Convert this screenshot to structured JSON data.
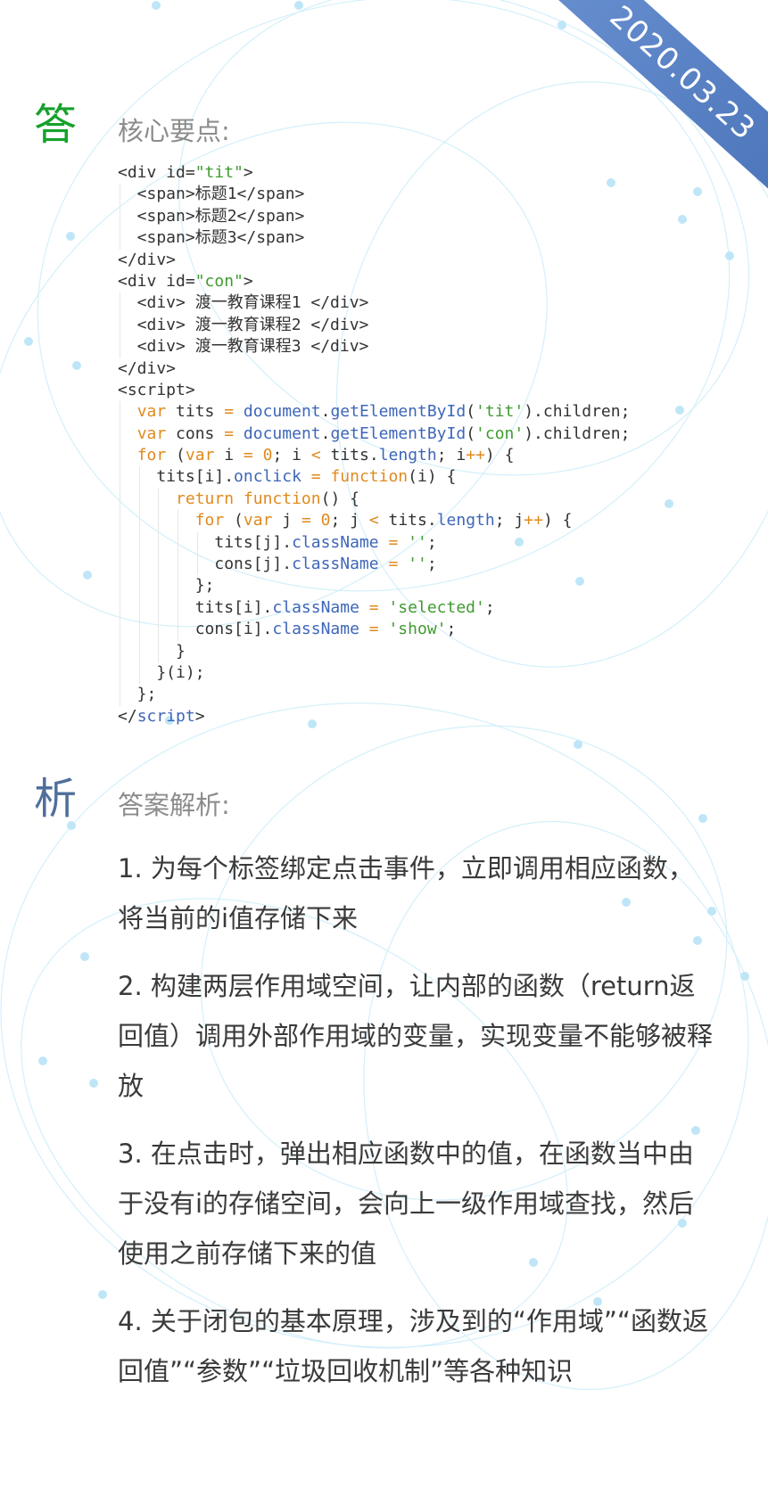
{
  "ribbon": {
    "date": "2020.03.23"
  },
  "answer": {
    "badge": "答",
    "title": "核心要点:",
    "code_lines": [
      [
        {
          "t": "<div id=",
          "c": "tag"
        },
        {
          "t": "\"tit\"",
          "c": "str"
        },
        {
          "t": ">",
          "c": "tag"
        }
      ],
      [
        {
          "t": "  <span>标题1</span>",
          "c": "tag"
        }
      ],
      [
        {
          "t": "  <span>标题2</span>",
          "c": "tag"
        }
      ],
      [
        {
          "t": "  <span>标题3</span>",
          "c": "tag"
        }
      ],
      [
        {
          "t": "</div>",
          "c": "tag"
        }
      ],
      [
        {
          "t": "<div id=",
          "c": "tag"
        },
        {
          "t": "\"con\"",
          "c": "str"
        },
        {
          "t": ">",
          "c": "tag"
        }
      ],
      [
        {
          "t": "  <div> 渡一教育课程1 </div>",
          "c": "tag"
        }
      ],
      [
        {
          "t": "  <div> 渡一教育课程2 </div>",
          "c": "tag"
        }
      ],
      [
        {
          "t": "  <div> 渡一教育课程3 </div>",
          "c": "tag"
        }
      ],
      [
        {
          "t": "</div>",
          "c": "tag"
        }
      ],
      [
        {
          "t": "<script>",
          "c": "tag"
        }
      ],
      [
        {
          "t": "  ",
          "c": ""
        },
        {
          "t": "var",
          "c": "kw"
        },
        {
          "t": " tits ",
          "c": ""
        },
        {
          "t": "=",
          "c": "kw"
        },
        {
          "t": " ",
          "c": ""
        },
        {
          "t": "document",
          "c": "fn"
        },
        {
          "t": ".",
          "c": ""
        },
        {
          "t": "getElementById",
          "c": "fn"
        },
        {
          "t": "(",
          "c": ""
        },
        {
          "t": "'tit'",
          "c": "str"
        },
        {
          "t": ").children;",
          "c": ""
        }
      ],
      [
        {
          "t": "  ",
          "c": ""
        },
        {
          "t": "var",
          "c": "kw"
        },
        {
          "t": " cons ",
          "c": ""
        },
        {
          "t": "=",
          "c": "kw"
        },
        {
          "t": " ",
          "c": ""
        },
        {
          "t": "document",
          "c": "fn"
        },
        {
          "t": ".",
          "c": ""
        },
        {
          "t": "getElementById",
          "c": "fn"
        },
        {
          "t": "(",
          "c": ""
        },
        {
          "t": "'con'",
          "c": "str"
        },
        {
          "t": ").children;",
          "c": ""
        }
      ],
      [
        {
          "t": "  ",
          "c": ""
        },
        {
          "t": "for",
          "c": "kw"
        },
        {
          "t": " (",
          "c": ""
        },
        {
          "t": "var",
          "c": "kw"
        },
        {
          "t": " i ",
          "c": ""
        },
        {
          "t": "=",
          "c": "kw"
        },
        {
          "t": " ",
          "c": ""
        },
        {
          "t": "0",
          "c": "kw"
        },
        {
          "t": "; i ",
          "c": ""
        },
        {
          "t": "<",
          "c": "kw"
        },
        {
          "t": " tits.",
          "c": ""
        },
        {
          "t": "length",
          "c": "fn"
        },
        {
          "t": "; i",
          "c": ""
        },
        {
          "t": "++",
          "c": "kw"
        },
        {
          "t": ") {",
          "c": ""
        }
      ],
      [
        {
          "t": "    tits[i].",
          "c": ""
        },
        {
          "t": "onclick",
          "c": "fn"
        },
        {
          "t": " ",
          "c": ""
        },
        {
          "t": "=",
          "c": "kw"
        },
        {
          "t": " ",
          "c": ""
        },
        {
          "t": "function",
          "c": "kw"
        },
        {
          "t": "(i) {",
          "c": ""
        }
      ],
      [
        {
          "t": "      ",
          "c": ""
        },
        {
          "t": "return",
          "c": "kw"
        },
        {
          "t": " ",
          "c": ""
        },
        {
          "t": "function",
          "c": "kw"
        },
        {
          "t": "() {",
          "c": ""
        }
      ],
      [
        {
          "t": "        ",
          "c": ""
        },
        {
          "t": "for",
          "c": "kw"
        },
        {
          "t": " (",
          "c": ""
        },
        {
          "t": "var",
          "c": "kw"
        },
        {
          "t": " j ",
          "c": ""
        },
        {
          "t": "=",
          "c": "kw"
        },
        {
          "t": " ",
          "c": ""
        },
        {
          "t": "0",
          "c": "kw"
        },
        {
          "t": "; j ",
          "c": ""
        },
        {
          "t": "<",
          "c": "kw"
        },
        {
          "t": " tits.",
          "c": ""
        },
        {
          "t": "length",
          "c": "fn"
        },
        {
          "t": "; j",
          "c": ""
        },
        {
          "t": "++",
          "c": "kw"
        },
        {
          "t": ") {",
          "c": ""
        }
      ],
      [
        {
          "t": "          tits[j].",
          "c": ""
        },
        {
          "t": "className",
          "c": "fn"
        },
        {
          "t": " ",
          "c": ""
        },
        {
          "t": "=",
          "c": "kw"
        },
        {
          "t": " ",
          "c": ""
        },
        {
          "t": "''",
          "c": "str"
        },
        {
          "t": ";",
          "c": ""
        }
      ],
      [
        {
          "t": "          cons[j].",
          "c": ""
        },
        {
          "t": "className",
          "c": "fn"
        },
        {
          "t": " ",
          "c": ""
        },
        {
          "t": "=",
          "c": "kw"
        },
        {
          "t": " ",
          "c": ""
        },
        {
          "t": "''",
          "c": "str"
        },
        {
          "t": ";",
          "c": ""
        }
      ],
      [
        {
          "t": "        };",
          "c": ""
        }
      ],
      [
        {
          "t": "        tits[i].",
          "c": ""
        },
        {
          "t": "className",
          "c": "fn"
        },
        {
          "t": " ",
          "c": ""
        },
        {
          "t": "=",
          "c": "kw"
        },
        {
          "t": " ",
          "c": ""
        },
        {
          "t": "'selected'",
          "c": "str"
        },
        {
          "t": ";",
          "c": ""
        }
      ],
      [
        {
          "t": "        cons[i].",
          "c": ""
        },
        {
          "t": "className",
          "c": "fn"
        },
        {
          "t": " ",
          "c": ""
        },
        {
          "t": "=",
          "c": "kw"
        },
        {
          "t": " ",
          "c": ""
        },
        {
          "t": "'show'",
          "c": "str"
        },
        {
          "t": ";",
          "c": ""
        }
      ],
      [
        {
          "t": "      }",
          "c": ""
        }
      ],
      [
        {
          "t": "    }(i);",
          "c": ""
        }
      ],
      [
        {
          "t": "  };",
          "c": ""
        }
      ],
      [
        {
          "t": "</",
          "c": "tag"
        },
        {
          "t": "script",
          "c": "fn"
        },
        {
          "t": ">",
          "c": "tag"
        }
      ]
    ]
  },
  "analysis": {
    "badge": "析",
    "title": "答案解析:",
    "points": [
      "1. 为每个标签绑定点击事件，立即调用相应函数，将当前的i值存储下来",
      "2. 构建两层作用域空间，让内部的函数（return返回值）调用外部作用域的变量，实现变量不能够被释放",
      "3. 在点击时，弹出相应函数中的值，在函数当中由于没有i的存储空间，会向上一级作用域查找，然后使用之前存储下来的值",
      "4. 关于闭包的基本原理，涉及到的“作用域”“函数返回值”“参数”“垃圾回收机制”等各种知识"
    ]
  },
  "colors": {
    "answer_badge": "#16a12c",
    "analysis_badge": "#4f6f9b",
    "ribbon": "#4a73b8",
    "keyword": "#e08a1e",
    "function": "#3e66b8",
    "string": "#3f9b30"
  }
}
